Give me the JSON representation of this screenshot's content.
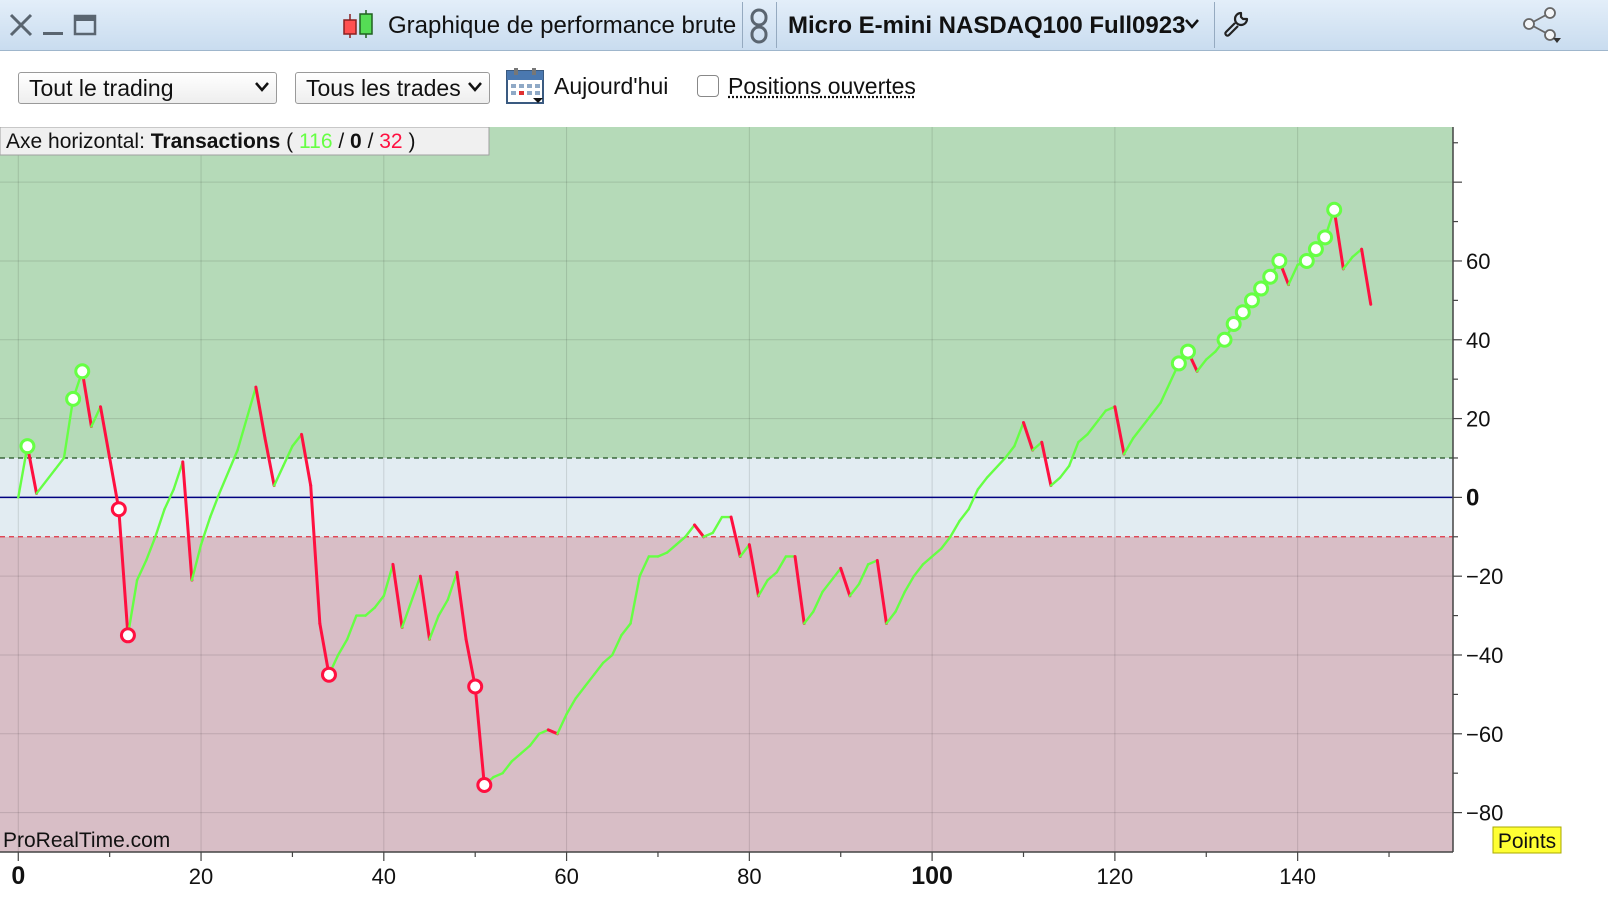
{
  "window": {
    "title": "Graphique de performance brute",
    "instrument": "Micro E-mini NASDAQ100 Full0923"
  },
  "toolbar": {
    "scope_select": "Tout le trading",
    "trades_select": "Tous les trades",
    "today_label": "Aujourd'hui",
    "open_positions_label": "Positions ouvertes",
    "open_positions_checked": false
  },
  "overlay": {
    "axis_label": "Axe horizontal:",
    "axis_mode": "Transactions",
    "paren_open": "(",
    "sep1": "/",
    "sep2": "/",
    "paren_close": ")",
    "wins": "116",
    "neutral": "0",
    "losses": "32"
  },
  "watermark": "ProRealTime.com",
  "unit_badge": "Points",
  "colors": {
    "gain": "#66ff44",
    "loss": "#ff1040",
    "profit_zone": "#b5dab8",
    "neutral_zone": "#e2ecf2",
    "loss_zone": "#d8bec6",
    "zero_line": "#000080",
    "badge_bg": "#ffff33"
  },
  "chart_data": {
    "type": "line",
    "x_axis": {
      "min": -2,
      "max": 157,
      "ticks": [
        "0",
        "20",
        "40",
        "60",
        "80",
        "100",
        "120",
        "140"
      ],
      "bold_ticks": [
        "0",
        "100"
      ]
    },
    "y_axis": {
      "min": -90,
      "max": 94,
      "ticks": [
        "60",
        "40",
        "20",
        "0",
        "−20",
        "−40",
        "−60",
        "−80"
      ],
      "bold_ticks": [
        "0"
      ],
      "position": "right"
    },
    "grid": true,
    "thresholds": {
      "upper": 10,
      "lower": -10
    },
    "series": [
      {
        "values": [
          [
            0,
            0
          ],
          [
            1,
            13
          ],
          [
            2,
            1
          ],
          [
            4,
            7
          ],
          [
            5,
            10
          ],
          [
            6,
            25
          ],
          [
            7,
            32
          ],
          [
            8,
            18
          ],
          [
            9,
            23
          ],
          [
            10,
            10
          ],
          [
            11,
            -3
          ],
          [
            12,
            -35
          ],
          [
            13,
            -21
          ],
          [
            14,
            -16
          ],
          [
            15,
            -10
          ],
          [
            16,
            -3
          ],
          [
            17,
            2
          ],
          [
            18,
            9
          ],
          [
            19,
            -21
          ],
          [
            20,
            -12
          ],
          [
            21,
            -5
          ],
          [
            22,
            1
          ],
          [
            24,
            12
          ],
          [
            26,
            28
          ],
          [
            27,
            15
          ],
          [
            28,
            3
          ],
          [
            29,
            8
          ],
          [
            30,
            13
          ],
          [
            31,
            16
          ],
          [
            32,
            3
          ],
          [
            33,
            -32
          ],
          [
            34,
            -45
          ],
          [
            35,
            -40
          ],
          [
            36,
            -36
          ],
          [
            37,
            -30
          ],
          [
            38,
            -30
          ],
          [
            39,
            -28
          ],
          [
            40,
            -25
          ],
          [
            41,
            -17
          ],
          [
            42,
            -33
          ],
          [
            44,
            -20
          ],
          [
            45,
            -36
          ],
          [
            46,
            -30
          ],
          [
            47,
            -26
          ],
          [
            48,
            -19
          ],
          [
            49,
            -36
          ],
          [
            50,
            -48
          ],
          [
            51,
            -73
          ],
          [
            52,
            -71
          ],
          [
            53,
            -70
          ],
          [
            54,
            -67
          ],
          [
            55,
            -65
          ],
          [
            56,
            -63
          ],
          [
            57,
            -60
          ],
          [
            58,
            -59
          ],
          [
            59,
            -60
          ],
          [
            60,
            -55
          ],
          [
            61,
            -51
          ],
          [
            62,
            -48
          ],
          [
            63,
            -45
          ],
          [
            64,
            -42
          ],
          [
            65,
            -40
          ],
          [
            66,
            -35
          ],
          [
            67,
            -32
          ],
          [
            68,
            -20
          ],
          [
            69,
            -15
          ],
          [
            70,
            -15
          ],
          [
            71,
            -14
          ],
          [
            72,
            -12
          ],
          [
            73,
            -10
          ],
          [
            74,
            -7
          ],
          [
            75,
            -10
          ],
          [
            76,
            -9
          ],
          [
            77,
            -5
          ],
          [
            78,
            -5
          ],
          [
            79,
            -15
          ],
          [
            80,
            -12
          ],
          [
            81,
            -25
          ],
          [
            82,
            -21
          ],
          [
            83,
            -19
          ],
          [
            84,
            -15
          ],
          [
            85,
            -15
          ],
          [
            86,
            -32
          ],
          [
            87,
            -29
          ],
          [
            88,
            -24
          ],
          [
            90,
            -18
          ],
          [
            91,
            -25
          ],
          [
            92,
            -22
          ],
          [
            93,
            -17
          ],
          [
            94,
            -16
          ],
          [
            95,
            -32
          ],
          [
            96,
            -29
          ],
          [
            97,
            -24
          ],
          [
            98,
            -20
          ],
          [
            99,
            -17
          ],
          [
            100,
            -15
          ],
          [
            101,
            -13
          ],
          [
            102,
            -10
          ],
          [
            103,
            -6
          ],
          [
            104,
            -3
          ],
          [
            105,
            2
          ],
          [
            106,
            5
          ],
          [
            108,
            10
          ],
          [
            109,
            13
          ],
          [
            110,
            19
          ],
          [
            111,
            12
          ],
          [
            112,
            14
          ],
          [
            113,
            3
          ],
          [
            114,
            5
          ],
          [
            115,
            8
          ],
          [
            116,
            14
          ],
          [
            117,
            16
          ],
          [
            119,
            22
          ],
          [
            120,
            23
          ],
          [
            121,
            11
          ],
          [
            122,
            15
          ],
          [
            124,
            21
          ],
          [
            125,
            24
          ],
          [
            126,
            29
          ],
          [
            127,
            34
          ],
          [
            128,
            37
          ],
          [
            129,
            32
          ],
          [
            130,
            35
          ],
          [
            131,
            37
          ],
          [
            132,
            40
          ],
          [
            133,
            44
          ],
          [
            134,
            47
          ],
          [
            135,
            50
          ],
          [
            136,
            53
          ],
          [
            137,
            56
          ],
          [
            138,
            60
          ],
          [
            139,
            54
          ],
          [
            140,
            59
          ],
          [
            141,
            60
          ],
          [
            142,
            63
          ],
          [
            143,
            66
          ],
          [
            144,
            73
          ],
          [
            145,
            58
          ],
          [
            146,
            61
          ],
          [
            147,
            63
          ],
          [
            148,
            49
          ]
        ]
      }
    ],
    "markers": [
      {
        "x": 1,
        "y": 13,
        "kind": "high"
      },
      {
        "x": 6,
        "y": 25,
        "kind": "high"
      },
      {
        "x": 7,
        "y": 32,
        "kind": "high"
      },
      {
        "x": 11,
        "y": -3,
        "kind": "low"
      },
      {
        "x": 12,
        "y": -35,
        "kind": "low"
      },
      {
        "x": 34,
        "y": -45,
        "kind": "low"
      },
      {
        "x": 50,
        "y": -48,
        "kind": "low"
      },
      {
        "x": 51,
        "y": -73,
        "kind": "low"
      },
      {
        "x": 127,
        "y": 34,
        "kind": "high"
      },
      {
        "x": 128,
        "y": 37,
        "kind": "high"
      },
      {
        "x": 132,
        "y": 40,
        "kind": "high"
      },
      {
        "x": 133,
        "y": 44,
        "kind": "high"
      },
      {
        "x": 134,
        "y": 47,
        "kind": "high"
      },
      {
        "x": 135,
        "y": 50,
        "kind": "high"
      },
      {
        "x": 136,
        "y": 53,
        "kind": "high"
      },
      {
        "x": 137,
        "y": 56,
        "kind": "high"
      },
      {
        "x": 138,
        "y": 60,
        "kind": "high"
      },
      {
        "x": 141,
        "y": 60,
        "kind": "high"
      },
      {
        "x": 142,
        "y": 63,
        "kind": "high"
      },
      {
        "x": 143,
        "y": 66,
        "kind": "high"
      },
      {
        "x": 144,
        "y": 73,
        "kind": "high"
      }
    ]
  }
}
